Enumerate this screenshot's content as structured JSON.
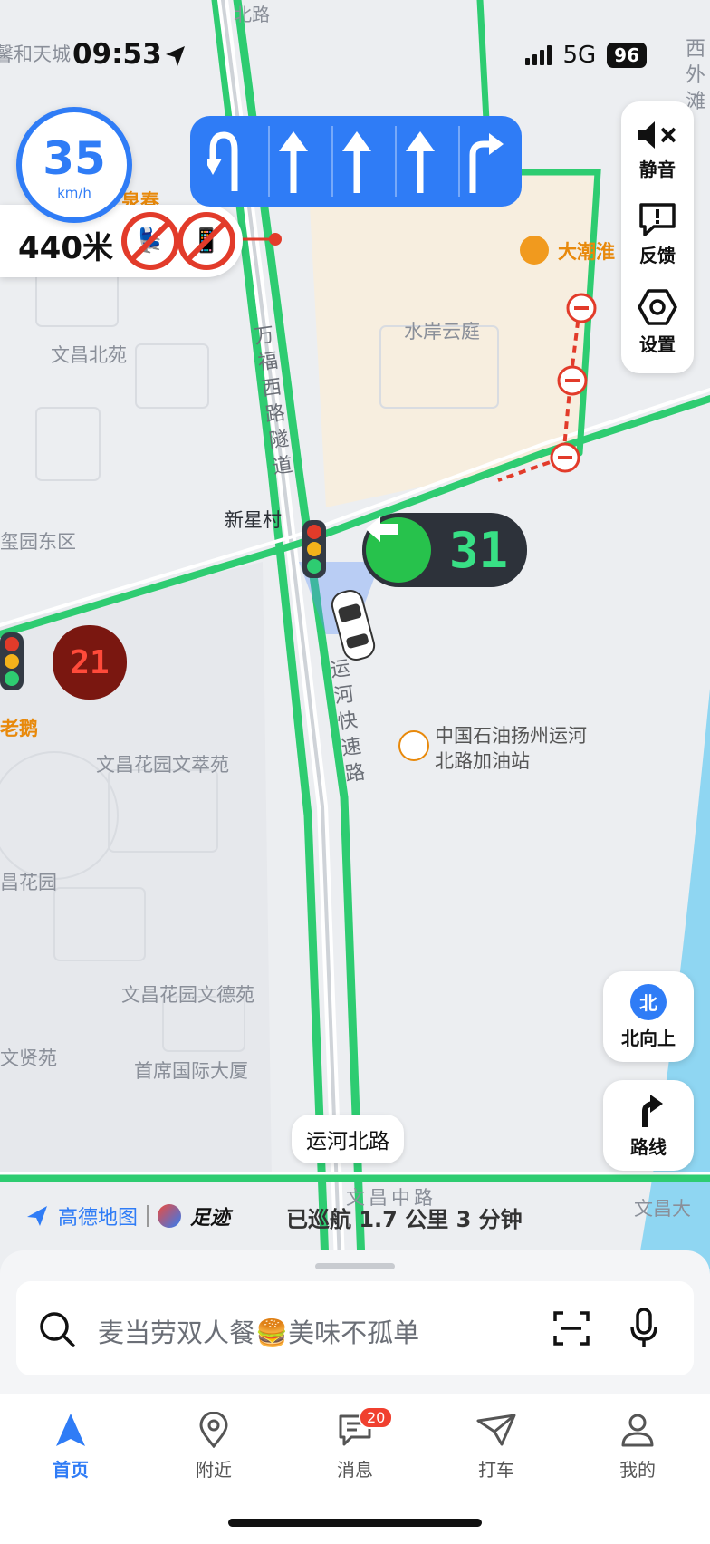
{
  "status_bar": {
    "time": "09:53",
    "network": "5G",
    "battery": "96"
  },
  "navigation": {
    "speed": "35",
    "speed_unit": "km/h",
    "distance": "440米",
    "lane_arrows": [
      "u-turn-left",
      "straight",
      "straight",
      "straight",
      "right"
    ]
  },
  "map": {
    "labels": {
      "top_left_community": "馨和天城",
      "top_road": "北路",
      "right_edge": "西外滩",
      "partial_spring": "泉春",
      "dachaohuai": "大潮淮",
      "shuian_yunting": "水岸云庭",
      "wenchang_beiyuan": "文昌北苑",
      "xixingcun": "新星村",
      "xiyuan_dongqu": "玺园东区",
      "laoe": "老鹅",
      "wencui": "文昌花园文萃苑",
      "petrochina": "中国石油扬州运河北路加油站",
      "wenchang_garden": "昌花园",
      "wende": "文昌花园文德苑",
      "wenxian": "文贤苑",
      "shouxi": "首席国际大厦",
      "wenchang_zhonglu": "文昌中路",
      "wenchang_right": "文昌大"
    },
    "tunnel_road": "万福西路隧道",
    "expressway": "运河快速路",
    "current_road": "运河北路"
  },
  "traffic_lights": {
    "main_countdown": "31",
    "left_countdown": "21"
  },
  "tools": {
    "mute": "静音",
    "feedback": "反馈",
    "settings": "设置",
    "north_badge": "北",
    "north_up": "北向上",
    "route": "路线"
  },
  "footer_info": {
    "brand": "高德地图",
    "zuji": "足迹",
    "cruise": "已巡航  1.7 公里  3 分钟"
  },
  "search": {
    "placeholder": "麦当劳双人餐🍔美味不孤单"
  },
  "tabs": [
    {
      "label": "首页"
    },
    {
      "label": "附近"
    },
    {
      "label": "消息",
      "badge": "20"
    },
    {
      "label": "打车"
    },
    {
      "label": "我的"
    }
  ],
  "colors": {
    "accent": "#2f7cf6",
    "road_green": "#2ecc71",
    "alert_red": "#e23b2a"
  }
}
